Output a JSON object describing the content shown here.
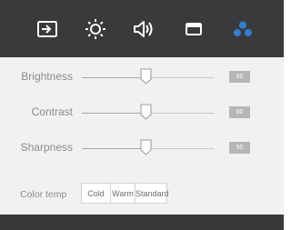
{
  "tabs": [
    {
      "icon": "input-source-icon",
      "active": false
    },
    {
      "icon": "brightness-sun-icon",
      "active": false
    },
    {
      "icon": "speaker-volume-icon",
      "active": false
    },
    {
      "icon": "window-display-icon",
      "active": false
    },
    {
      "icon": "color-dots-icon",
      "active": true
    }
  ],
  "colors": {
    "topbar_bg": "#3a3a3c",
    "icon_white": "#ffffff",
    "active_icon": "#2f7fd4",
    "content_bg": "#f1f1f1",
    "label_text": "#8b8b8b",
    "badge_bg": "#b6b6b6"
  },
  "settings": {
    "brightness": {
      "label": "Brightness",
      "value": "50",
      "fraction": 0.5
    },
    "contrast": {
      "label": "Contrast",
      "value": "50",
      "fraction": 0.5
    },
    "sharpness": {
      "label": "Sharpness",
      "value": "50",
      "fraction": 0.5
    }
  },
  "color_temp": {
    "label": "Color temp",
    "options": [
      "Cold",
      "Warm",
      "Standard"
    ]
  }
}
